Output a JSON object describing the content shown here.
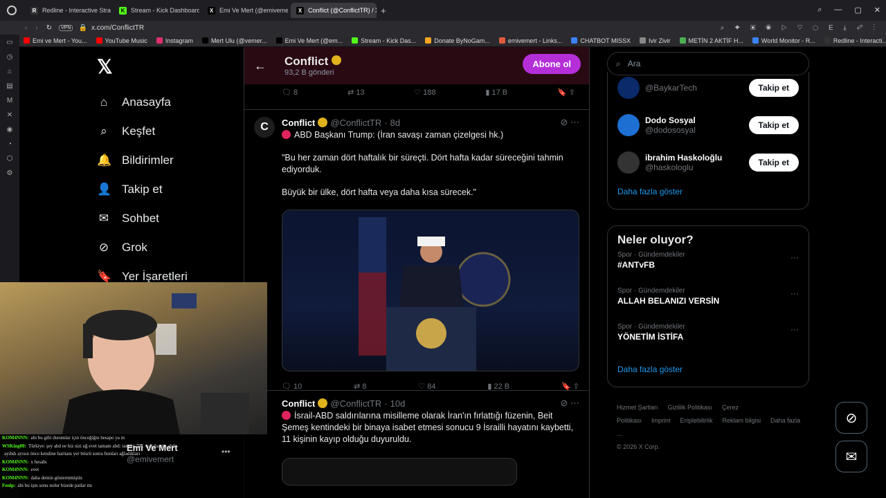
{
  "browser": {
    "tabs": [
      {
        "label": "Redline - Interactive Strat",
        "fav": "R",
        "color": "#333",
        "active": false
      },
      {
        "label": "Stream - Kick Dashboard",
        "fav": "K",
        "color": "#53fc18",
        "active": false
      },
      {
        "label": "Emi Ve Mert (@emivemert",
        "fav": "X",
        "color": "#000",
        "active": false
      },
      {
        "label": "Conflict (@ConflictTR) / X",
        "fav": "X",
        "color": "#000",
        "active": true
      }
    ],
    "url": "x.com/ConflictTR",
    "vpn": "VPN",
    "bookmarks": [
      {
        "label": "Emi ve Mert - You...",
        "color": "#ff0000"
      },
      {
        "label": "YouTube Music",
        "color": "#ff0000"
      },
      {
        "label": "Instagram",
        "color": "#e1306c"
      },
      {
        "label": "Mert Ulu (@vemer...",
        "color": "#000"
      },
      {
        "label": "Emi Ve Mert (@em...",
        "color": "#000"
      },
      {
        "label": "Stream - Kick Das...",
        "color": "#53fc18"
      },
      {
        "label": "Donate ByNoGam...",
        "color": "#f5a623"
      },
      {
        "label": "emivemert - Links...",
        "color": "#e05c3b"
      },
      {
        "label": "CHATBOT MISSX",
        "color": "#3b82f6"
      },
      {
        "label": "Ivir Zivir",
        "color": "#888"
      },
      {
        "label": "METİN 2 AKTİF H...",
        "color": "#4caf50"
      },
      {
        "label": "World Monitor - R...",
        "color": "#3b82f6"
      },
      {
        "label": "Redline - Interacti...",
        "color": "#333"
      }
    ]
  },
  "nav": {
    "items": [
      {
        "label": "Anasayfa",
        "icon": "home-icon",
        "glyph": "⌂"
      },
      {
        "label": "Keşfet",
        "icon": "search-icon",
        "glyph": "⌕"
      },
      {
        "label": "Bildirimler",
        "icon": "bell-icon",
        "glyph": "🔔"
      },
      {
        "label": "Takip et",
        "icon": "person-add-icon",
        "glyph": "👤"
      },
      {
        "label": "Sohbet",
        "icon": "mail-icon",
        "glyph": "✉"
      },
      {
        "label": "Grok",
        "icon": "grok-icon",
        "glyph": "⊘"
      },
      {
        "label": "Yer İşaretleri",
        "icon": "bookmark-icon",
        "glyph": "🔖"
      }
    ]
  },
  "header": {
    "name": "Conflict",
    "posts": "93,2 B gönderi",
    "subscribe": "Abone ol"
  },
  "prev_actions": {
    "reply": "8",
    "retweet": "13",
    "like": "188",
    "views": "17 B"
  },
  "posts": [
    {
      "name": "Conflict",
      "handle": "@ConflictTR",
      "time": "8d",
      "lines": [
        "ABD Başkanı Trump: (İran savaşı zaman çizelgesi hk.)",
        "\"Bu her zaman dört haftalık bir süreçti. Dört hafta kadar süreceğini tahmin ediyorduk.",
        "Büyük bir ülke, dört hafta veya daha kısa sürecek.\""
      ],
      "actions": {
        "reply": "10",
        "retweet": "8",
        "like": "84",
        "views": "22 B"
      }
    },
    {
      "name": "Conflict",
      "handle": "@ConflictTR",
      "time": "10d",
      "lines": [
        "İsrail-ABD saldırılarına misilleme olarak İran'ın fırlattığı füzenin, Beit Şemeş kentindeki bir binaya isabet etmesi sonucu 9 İsrailli hayatını kaybetti, 11 kişinin kayıp olduğu duyuruldu."
      ]
    }
  ],
  "search": {
    "placeholder": "Ara"
  },
  "who_to_follow": {
    "items": [
      {
        "name": "",
        "handle": "@BaykarTech",
        "button": "Takip et"
      },
      {
        "name": "Dodo Sosyal",
        "handle": "@dodososyal",
        "button": "Takip et"
      },
      {
        "name": "ibrahim Haskoloğlu",
        "handle": "@haskologlu",
        "button": "Takip et"
      }
    ],
    "more": "Daha fazla göster"
  },
  "trends": {
    "title": "Neler oluyor?",
    "items": [
      {
        "category": "Spor · Gündemdekiler",
        "name": "#ANTvFB"
      },
      {
        "category": "Spor · Gündemdekiler",
        "name": "ALLAH BELANIZI VERSİN"
      },
      {
        "category": "Spor · Gündemdekiler",
        "name": "YÖNETİM İSTİFA"
      }
    ],
    "more": "Daha fazla göster"
  },
  "footer": {
    "links": [
      "Hizmet Şartları",
      "Gizlilik Politikası",
      "Çerez Politikası",
      "Imprint",
      "Erişilebilirlik",
      "Reklam bilgisi",
      "Daha fazla ..."
    ],
    "copyright": "© 2026 X Corp."
  },
  "profile": {
    "name": "Emi Ve Mert",
    "handle": "@emivemert"
  },
  "chat": [
    {
      "user": "KOM4NNN:",
      "text": "abi bu gibi durumlar için önceğiğin hesapo ya m"
    },
    {
      "user": "WSKing00:",
      "text": "Türkiye: şey abd ee biz sizi uğ evet tamam abd: tamam TR: vallaha mu abd:"
    },
    {
      "user": "",
      "text": "ayıbdı ayısın önce kendine haritanı yer bösrü sonra bunları ağladıkları"
    },
    {
      "user": "KOM4NNN:",
      "text": "x hesabı"
    },
    {
      "user": "KOM4NNN:",
      "text": "evet"
    },
    {
      "user": "KOM4NNN:",
      "text": "daha demin göstermmiştin"
    },
    {
      "user": "Fenlp:",
      "text": "abi bu işin sonu nolur bizede patlar mı"
    }
  ]
}
